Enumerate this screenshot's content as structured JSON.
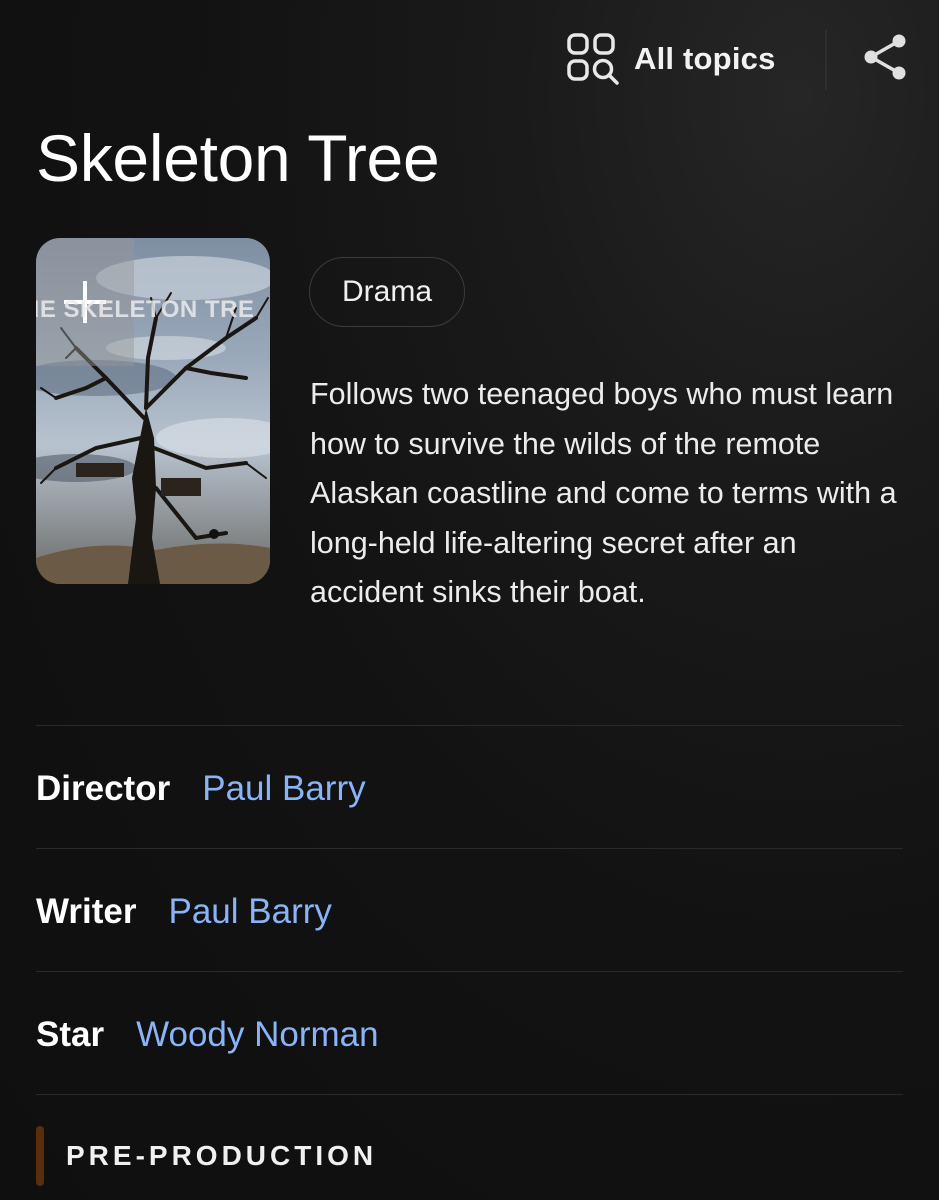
{
  "header": {
    "all_topics_label": "All topics",
    "all_topics_icon": "grid-search-icon",
    "share_icon": "share-icon"
  },
  "entity": {
    "title": "Skeleton Tree",
    "poster_text": "HE SKELETON TRE",
    "genre": "Drama",
    "description": "Follows two teenaged boys who must learn how to survive the wilds of the remote Alaskan coastline and come to terms with a long-held life-altering secret after an accident sinks their boat."
  },
  "credits": [
    {
      "label": "Director",
      "value": "Paul Barry"
    },
    {
      "label": "Writer",
      "value": "Paul Barry"
    },
    {
      "label": "Star",
      "value": "Woody Norman"
    }
  ],
  "status": {
    "label": "PRE-PRODUCTION",
    "accent_color": "#5a2d0c"
  },
  "colors": {
    "background": "#121212",
    "link": "#8ab4f8",
    "text": "#ffffff"
  }
}
